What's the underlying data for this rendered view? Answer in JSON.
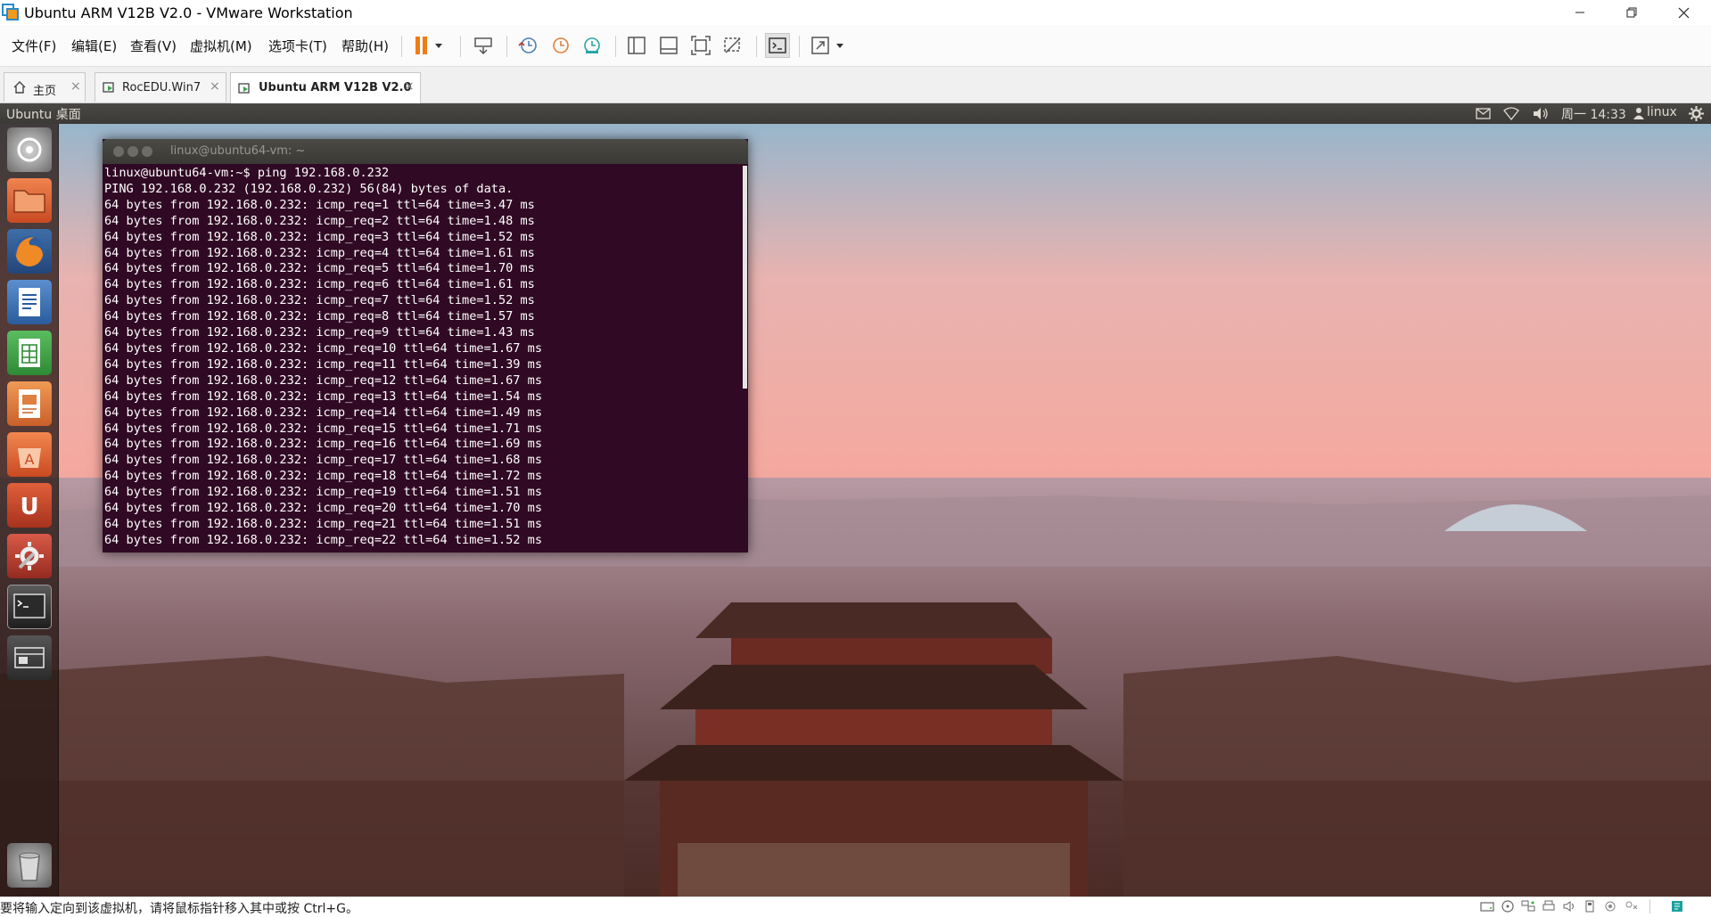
{
  "window": {
    "title": "Ubuntu ARM V12B V2.0 - VMware Workstation"
  },
  "menu": {
    "file": "文件(F)",
    "edit": "编辑(E)",
    "view": "查看(V)",
    "vm": "虚拟机(M)",
    "tabs": "选项卡(T)",
    "help": "帮助(H)"
  },
  "tabs": [
    {
      "label": "主页"
    },
    {
      "label": "RocEDU.Win7"
    },
    {
      "label": "Ubuntu ARM V12B V2.0"
    }
  ],
  "tab_close": "×",
  "ubuntu_panel": {
    "desktop_title": "Ubuntu 桌面",
    "clock": "周一 14:33",
    "user": "linux"
  },
  "terminal": {
    "title": "linux@ubuntu64-vm: ~",
    "lines": [
      "linux@ubuntu64-vm:~$ ping 192.168.0.232",
      "PING 192.168.0.232 (192.168.0.232) 56(84) bytes of data.",
      "64 bytes from 192.168.0.232: icmp_req=1 ttl=64 time=3.47 ms",
      "64 bytes from 192.168.0.232: icmp_req=2 ttl=64 time=1.48 ms",
      "64 bytes from 192.168.0.232: icmp_req=3 ttl=64 time=1.52 ms",
      "64 bytes from 192.168.0.232: icmp_req=4 ttl=64 time=1.61 ms",
      "64 bytes from 192.168.0.232: icmp_req=5 ttl=64 time=1.70 ms",
      "64 bytes from 192.168.0.232: icmp_req=6 ttl=64 time=1.61 ms",
      "64 bytes from 192.168.0.232: icmp_req=7 ttl=64 time=1.52 ms",
      "64 bytes from 192.168.0.232: icmp_req=8 ttl=64 time=1.57 ms",
      "64 bytes from 192.168.0.232: icmp_req=9 ttl=64 time=1.43 ms",
      "64 bytes from 192.168.0.232: icmp_req=10 ttl=64 time=1.67 ms",
      "64 bytes from 192.168.0.232: icmp_req=11 ttl=64 time=1.39 ms",
      "64 bytes from 192.168.0.232: icmp_req=12 ttl=64 time=1.67 ms",
      "64 bytes from 192.168.0.232: icmp_req=13 ttl=64 time=1.54 ms",
      "64 bytes from 192.168.0.232: icmp_req=14 ttl=64 time=1.49 ms",
      "64 bytes from 192.168.0.232: icmp_req=15 ttl=64 time=1.71 ms",
      "64 bytes from 192.168.0.232: icmp_req=16 ttl=64 time=1.69 ms",
      "64 bytes from 192.168.0.232: icmp_req=17 ttl=64 time=1.68 ms",
      "64 bytes from 192.168.0.232: icmp_req=18 ttl=64 time=1.72 ms",
      "64 bytes from 192.168.0.232: icmp_req=19 ttl=64 time=1.51 ms",
      "64 bytes from 192.168.0.232: icmp_req=20 ttl=64 time=1.70 ms",
      "64 bytes from 192.168.0.232: icmp_req=21 ttl=64 time=1.51 ms",
      "64 bytes from 192.168.0.232: icmp_req=22 ttl=64 time=1.52 ms"
    ]
  },
  "launcher": [
    {
      "icon": "dash-home-icon",
      "color": "#9a9a9a"
    },
    {
      "icon": "files-icon",
      "color": "#e2643a"
    },
    {
      "icon": "firefox-icon",
      "color": "#e8772e"
    },
    {
      "icon": "writer-icon",
      "color": "#2a6fb8"
    },
    {
      "icon": "calc-icon",
      "color": "#2f9a3a"
    },
    {
      "icon": "impress-icon",
      "color": "#d9672b"
    },
    {
      "icon": "software-center-icon",
      "color": "#e0612f"
    },
    {
      "icon": "ubuntu-one-icon",
      "color": "#d4512b"
    },
    {
      "icon": "system-settings-icon",
      "color": "#c23a2a"
    },
    {
      "icon": "terminal-icon",
      "color": "#2c2c2c"
    },
    {
      "icon": "workspace-switcher-icon",
      "color": "#3a3a3a"
    },
    {
      "icon": "trash-icon",
      "color": "#8a8a8a"
    }
  ],
  "statusbar": {
    "message": "要将输入定向到该虚拟机，请将鼠标指针移入其中或按 Ctrl+G。"
  },
  "colors": {
    "terminal_bg": "#300a24",
    "panel_bg": "#3c3b37",
    "pause_accent": "#f07b14"
  }
}
